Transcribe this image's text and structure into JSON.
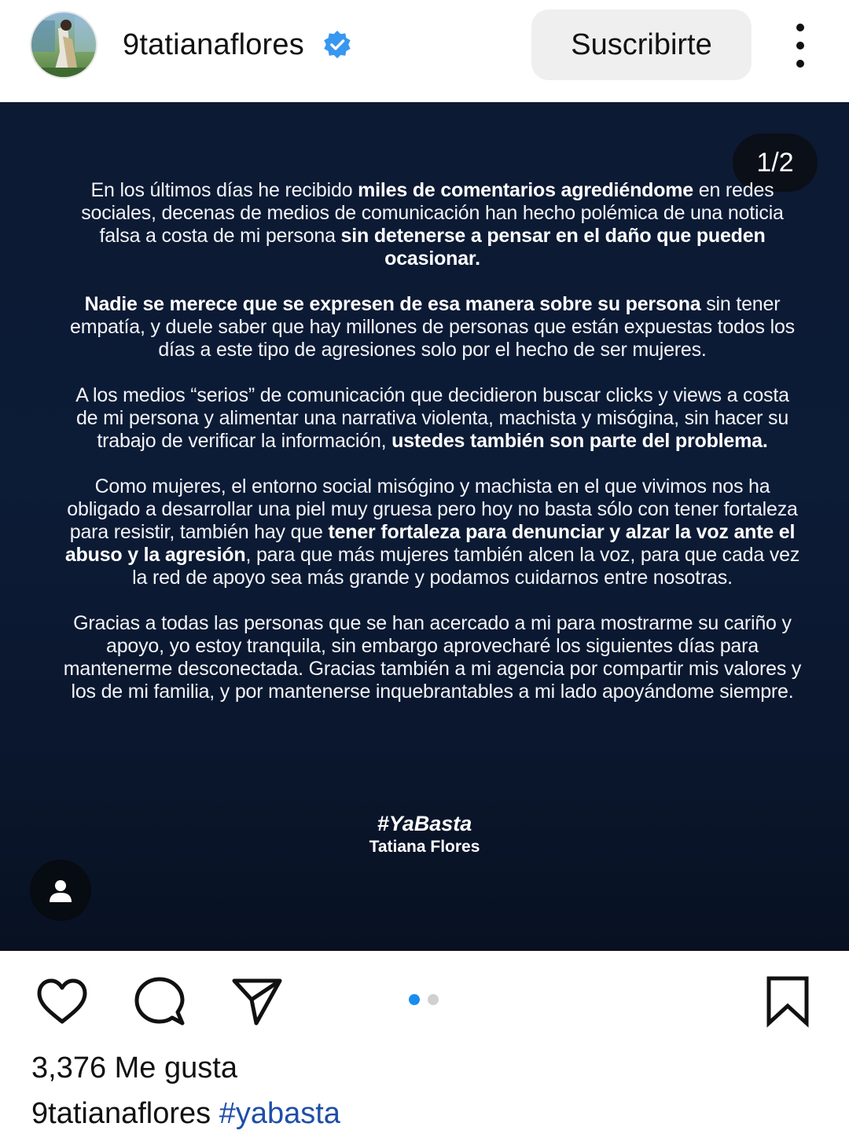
{
  "header": {
    "username": "9tatianaflores",
    "subscribe_label": "Suscribirte",
    "verified_icon": "verified-badge-icon",
    "more_icon": "more-options-icon",
    "accent_color": "#3897f0"
  },
  "post": {
    "counter": "1/2",
    "paragraphs": [
      [
        {
          "t": "En los últimos días he recibido ",
          "b": false
        },
        {
          "t": "miles de comentarios agrediéndome",
          "b": true
        },
        {
          "t": " en redes sociales, decenas de medios de comunicación han hecho polémica de una noticia falsa a costa de mi persona ",
          "b": false
        },
        {
          "t": "sin detenerse a pensar en el daño que pueden ocasionar.",
          "b": true
        }
      ],
      [
        {
          "t": "Nadie se merece que se expresen de esa manera sobre su persona",
          "b": true
        },
        {
          "t": " sin tener empatía, y duele saber que hay millones de personas que están expuestas todos los días a este tipo de agresiones solo por el hecho de ser mujeres.",
          "b": false
        }
      ],
      [
        {
          "t": "A los medios “serios” de comunicación que decidieron buscar clicks y views a costa de mi persona y alimentar una narrativa violenta, machista y misógina, sin hacer su trabajo de verificar la información, ",
          "b": false
        },
        {
          "t": "ustedes también son parte del problema.",
          "b": true
        }
      ],
      [
        {
          "t": "Como mujeres, el entorno social misógino y machista en el que vivimos nos ha obligado a desarrollar una piel muy gruesa pero hoy no basta sólo con tener fortaleza para resistir, también hay que ",
          "b": false
        },
        {
          "t": "tener fortaleza para denunciar y alzar la voz ante el abuso y la agresión",
          "b": true
        },
        {
          "t": ", para que más mujeres también alcen la voz, para que cada vez la red de apoyo sea más grande y podamos cuidarnos entre nosotras.",
          "b": false
        }
      ],
      [
        {
          "t": "Gracias a todas las personas que se han acercado a mi para mostrarme su cariño y apoyo, yo estoy tranquila, sin embargo aprovecharé los siguientes días para mantenerme desconectada. Gracias también a mi agencia por compartir mis valores y los de mi familia, y por mantenerse inquebrantables a mi lado apoyándome siempre.",
          "b": false
        }
      ]
    ],
    "hashtag": "#YaBasta",
    "signature": "Tatiana Flores",
    "tag_icon": "person-tag-icon",
    "background_color": "#0c1a33"
  },
  "actions": {
    "like_icon": "heart-icon",
    "comment_icon": "comment-icon",
    "share_icon": "send-icon",
    "save_icon": "bookmark-icon",
    "carousel": {
      "total": 2,
      "current": 1
    }
  },
  "likes_text": "3,376 Me gusta",
  "caption": {
    "username": "9tatianaflores",
    "hashtag": "#yabasta"
  }
}
